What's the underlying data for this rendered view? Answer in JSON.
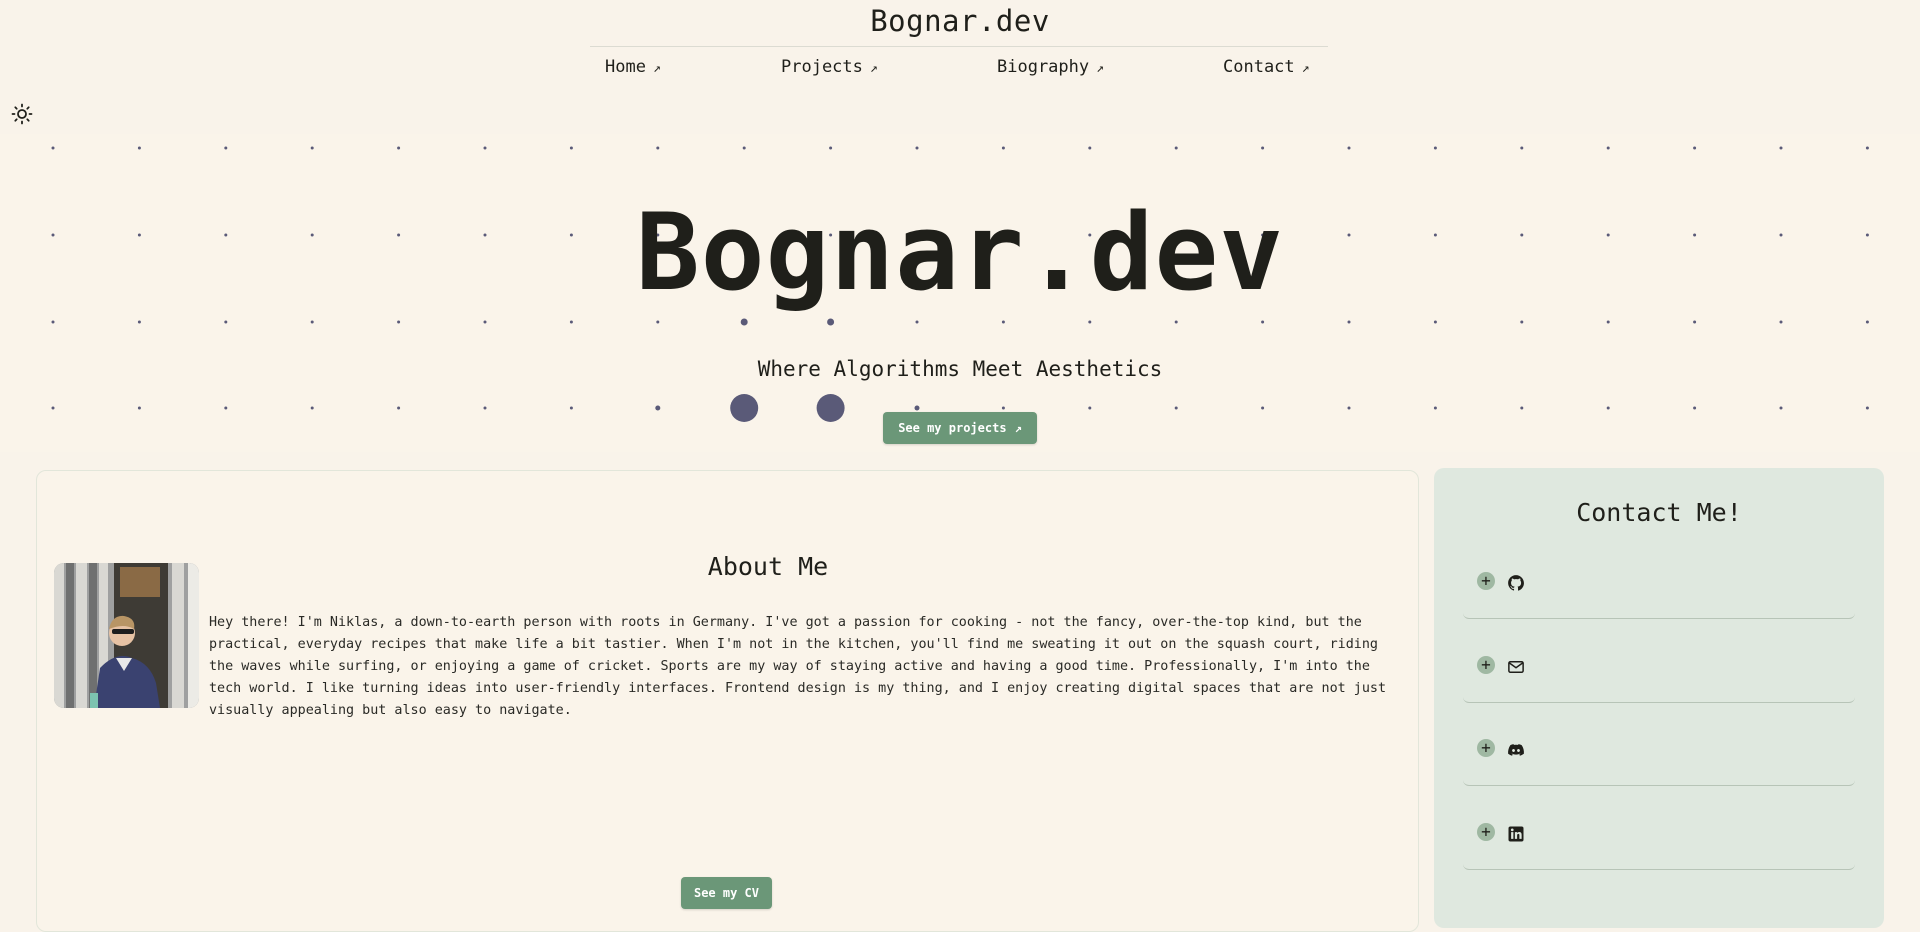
{
  "header": {
    "site_title": "Bognar.dev",
    "nav": [
      {
        "label": "Home",
        "arrow": "↗"
      },
      {
        "label": "Projects",
        "arrow": "↗"
      },
      {
        "label": "Biography",
        "arrow": "↗"
      },
      {
        "label": "Contact",
        "arrow": "↗"
      }
    ],
    "theme_toggle_icon": "sun-icon"
  },
  "hero": {
    "title": "Bognar.dev",
    "subtitle": "Where Algorithms Meet Aesthetics",
    "cta_label": "See my projects",
    "cta_arrow": "↗"
  },
  "about": {
    "title": "About Me",
    "text": "Hey there! I'm Niklas, a down-to-earth person with roots in Germany. I've got a passion for cooking - not the fancy, over-the-top kind, but the practical, everyday recipes that make life a bit tastier. When I'm not in the kitchen, you'll find me sweating it out on the squash court, riding the waves while surfing, or enjoying a game of cricket. Sports are my way of staying active and having a good time. Professionally, I'm into the tech world. I like turning ideas into user-friendly interfaces. Frontend design is my thing, and I enjoy creating digital spaces that are not just visually appealing but also easy to navigate.",
    "cv_label": "See my CV"
  },
  "contact": {
    "title": "Contact Me!",
    "items": [
      {
        "icon": "github-icon",
        "expand": "+"
      },
      {
        "icon": "mail-icon",
        "expand": "+"
      },
      {
        "icon": "discord-icon",
        "expand": "+"
      },
      {
        "icon": "linkedin-icon",
        "expand": "+"
      }
    ]
  },
  "colors": {
    "background": "#f9f3ea",
    "accent_green": "#6b9778",
    "contact_bg": "#dfe8df",
    "dot": "#5a5a78",
    "text": "#1f1f1a"
  }
}
